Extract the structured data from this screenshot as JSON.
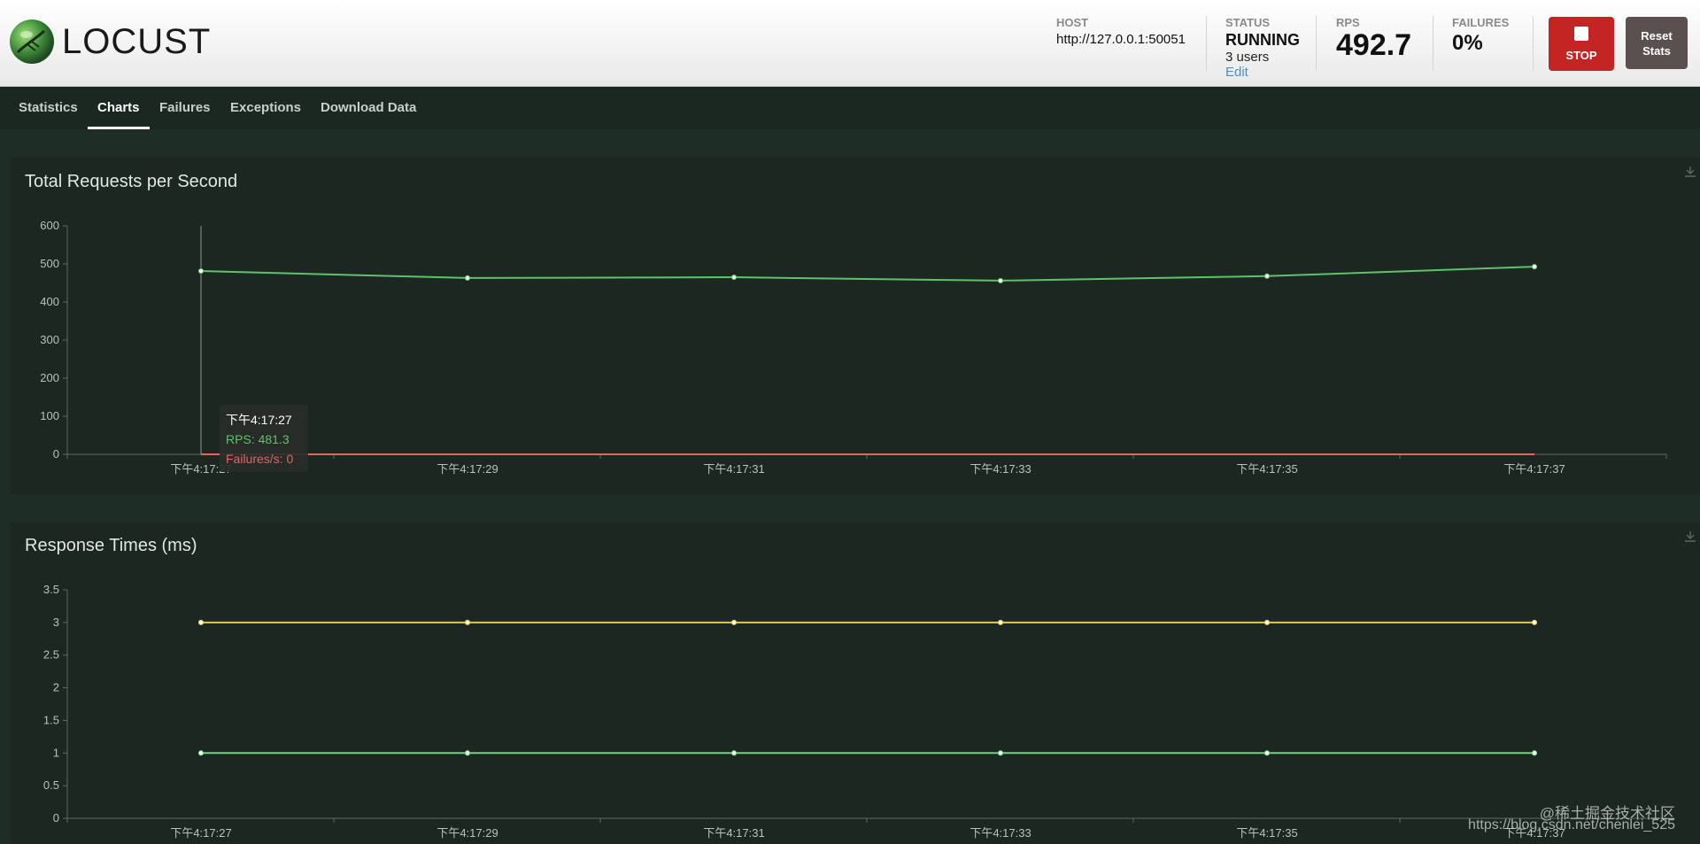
{
  "header": {
    "logo_text": "LOCUST",
    "host": {
      "label": "HOST",
      "value": "http://127.0.0.1:50051"
    },
    "status": {
      "label": "STATUS",
      "value": "RUNNING",
      "users": "3 users",
      "edit": "Edit"
    },
    "rps": {
      "label": "RPS",
      "value": "492.7"
    },
    "failures": {
      "label": "FAILURES",
      "value": "0%"
    },
    "stop_label": "STOP",
    "reset_label_1": "Reset",
    "reset_label_2": "Stats"
  },
  "nav": {
    "tabs": [
      {
        "label": "Statistics",
        "active": false
      },
      {
        "label": "Charts",
        "active": true
      },
      {
        "label": "Failures",
        "active": false
      },
      {
        "label": "Exceptions",
        "active": false
      },
      {
        "label": "Download Data",
        "active": false
      }
    ]
  },
  "colors": {
    "rps_line": "#5fc26a",
    "failures_line": "#e06666",
    "median_line": "#e8c84a",
    "p95_line": "#6fd47a",
    "panel_bg": "#1b2720"
  },
  "tooltip": {
    "time": "下午4:17:27",
    "rps": "RPS: 481.3",
    "failures": "Failures/s: 0"
  },
  "watermark": {
    "line1": "@稀土掘金技术社区",
    "line2": "https://blog.csdn.net/chenlei_525"
  },
  "chart_data": [
    {
      "type": "line",
      "title": "Total Requests per Second",
      "x": [
        "下午4:17:27",
        "下午4:17:29",
        "下午4:17:31",
        "下午4:17:33",
        "下午4:17:35",
        "下午4:17:37"
      ],
      "series": [
        {
          "name": "RPS",
          "values": [
            481.3,
            463,
            465,
            456,
            468,
            492.7
          ]
        },
        {
          "name": "Failures/s",
          "values": [
            0,
            0,
            0,
            0,
            0,
            0
          ]
        }
      ],
      "yticks": [
        "0",
        "100",
        "200",
        "300",
        "400",
        "500",
        "600"
      ],
      "ylim": [
        0,
        600
      ],
      "grid": false
    },
    {
      "type": "line",
      "title": "Response Times (ms)",
      "x": [
        "下午4:17:27",
        "下午4:17:29",
        "下午4:17:31",
        "下午4:17:33",
        "下午4:17:35",
        "下午4:17:37"
      ],
      "series": [
        {
          "values": [
            3,
            3,
            3,
            3,
            3,
            3
          ]
        },
        {
          "values": [
            1,
            1,
            1,
            1,
            1,
            1
          ]
        }
      ],
      "yticks": [
        "0",
        "0.5",
        "1",
        "1.5",
        "2",
        "2.5",
        "3",
        "3.5"
      ],
      "ylim": [
        0,
        3.5
      ],
      "grid": false
    }
  ]
}
